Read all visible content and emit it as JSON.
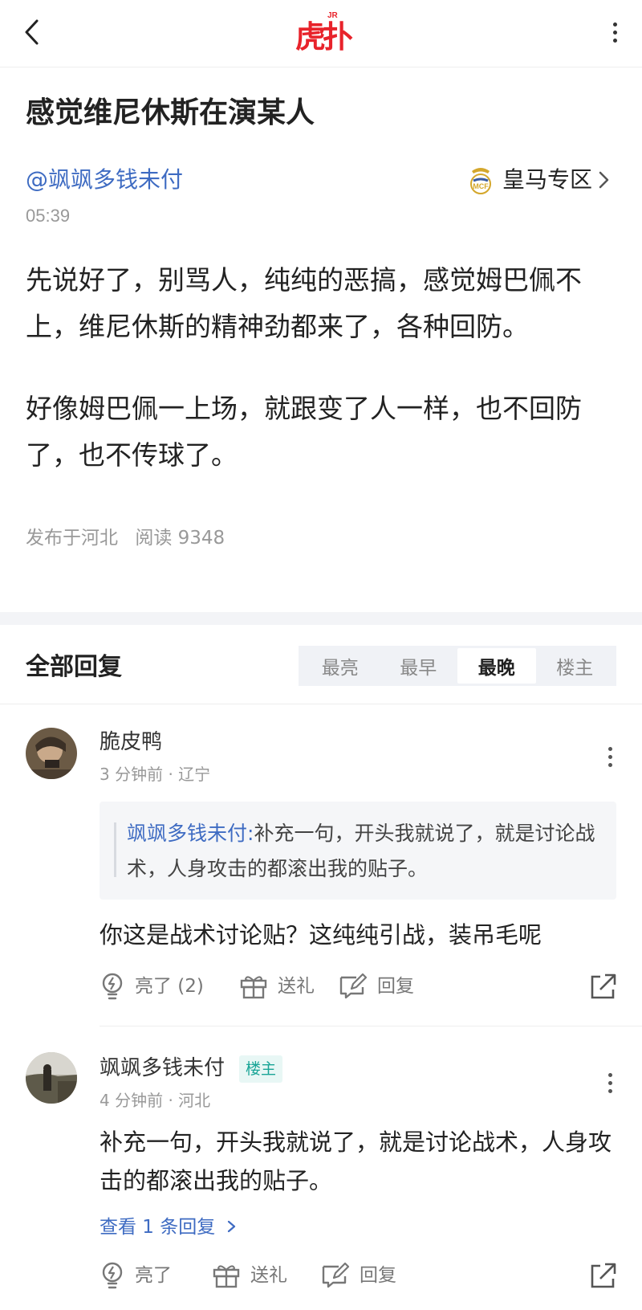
{
  "nav": {
    "logo_text": "虎扑",
    "logo_badge": "JR",
    "back_icon": "chevron-left-icon",
    "more_icon": "vertical-dots-icon"
  },
  "post": {
    "title": "感觉维尼休斯在演某人",
    "author": "@飒飒多钱未付",
    "time": "05:39",
    "zone_label": "皇马专区",
    "paragraphs": [
      "先说好了，别骂人，纯纯的恶搞，感觉姆巴佩不上，维尼休斯的精神劲都来了，各种回防。",
      "好像姆巴佩一上场，就跟变了人一样，也不回防了，也不传球了。"
    ],
    "location": "发布于河北",
    "reads": "阅读 9348"
  },
  "replies": {
    "header": "全部回复",
    "sort_tabs": [
      "最亮",
      "最早",
      "最晚",
      "楼主"
    ],
    "active_tab": "最晚",
    "items": [
      {
        "username": "脆皮鸭",
        "meta": "3 分钟前 · 辽宁",
        "quote_author": "飒飒多钱未付:",
        "quote_text": "补充一句，开头我就说了，就是讨论战术，人身攻击的都滚出我的贴子。",
        "text": "你这是战术讨论贴？这纯纯引战，装吊毛呢",
        "like_label": "亮了 (2)",
        "gift_label": "送礼",
        "reply_label": "回复"
      },
      {
        "username": "飒飒多钱未付",
        "op_tag": "楼主",
        "meta": "4 分钟前 · 河北",
        "text": "补充一句，开头我就说了，就是讨论战术，人身攻击的都滚出我的贴子。",
        "view_replies": "查看 1 条回复",
        "like_label": "亮了",
        "gift_label": "送礼",
        "reply_label": "回复"
      }
    ]
  },
  "colors": {
    "brand_red": "#e8232b",
    "link_blue": "#3e6bc2",
    "op_green": "#1aa597",
    "muted": "#999999"
  }
}
